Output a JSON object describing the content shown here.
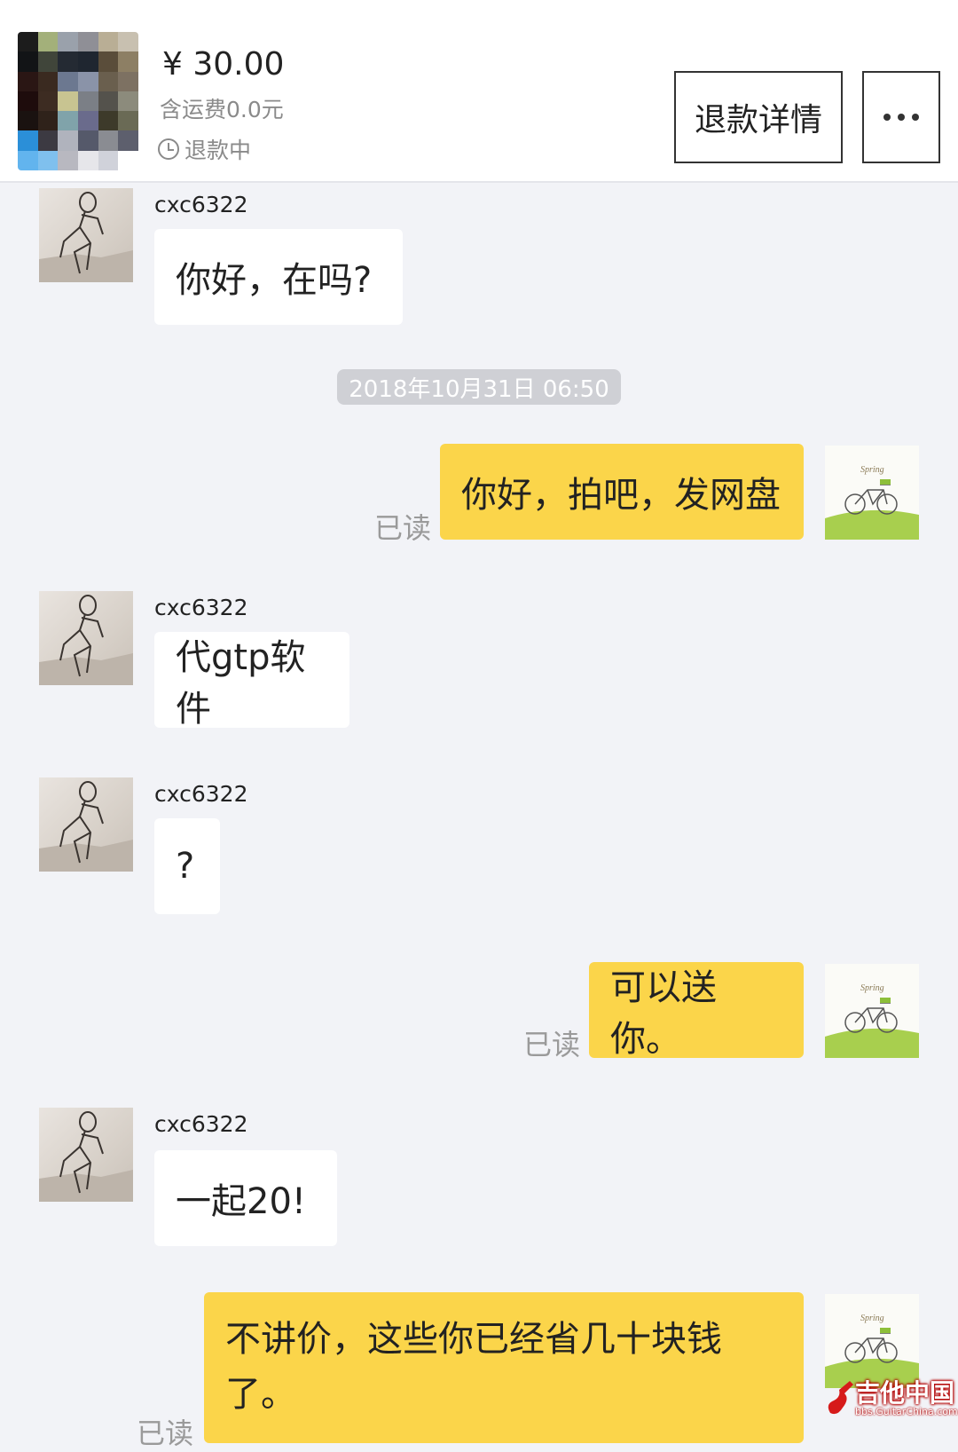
{
  "header": {
    "price": "¥ 30.00",
    "shipping": "含运费0.0元",
    "status": "退款中",
    "refund_button": "退款详情",
    "more_icon": "more-dots-icon"
  },
  "timestamp": "2018年10月31日 06:50",
  "messages": [
    {
      "side": "in",
      "user": "cxc6322",
      "text": "你好，在吗?"
    },
    {
      "side": "out",
      "text": "你好，拍吧，发网盘",
      "read": "已读"
    },
    {
      "side": "in",
      "user": "cxc6322",
      "text": "代gtp软件"
    },
    {
      "side": "in",
      "user": "cxc6322",
      "text": "?"
    },
    {
      "side": "out",
      "text": "可以送你。",
      "read": "已读"
    },
    {
      "side": "in",
      "user": "cxc6322",
      "text": "一起20!"
    },
    {
      "side": "out",
      "text_line1": "不讲价，这些你已经省几十块钱",
      "text_line2": "了。",
      "read": "已读"
    }
  ],
  "avatar_right_label": "Spring",
  "watermark": {
    "line1": "吉他中国",
    "line2": "bbs.GuitarChina.com"
  },
  "colors": {
    "outgoing_bubble": "#fbd54a",
    "incoming_bubble": "#ffffff",
    "background": "#f2f3f7"
  }
}
